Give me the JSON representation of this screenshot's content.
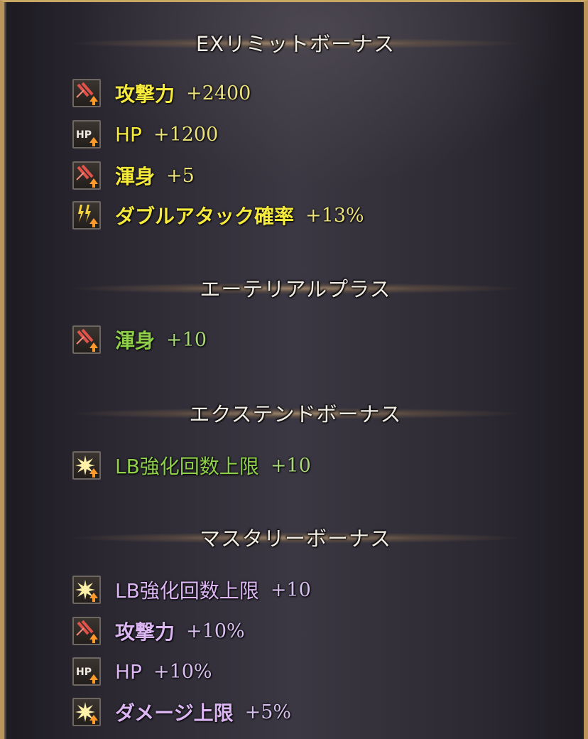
{
  "sections": [
    {
      "title": "EXリミットボーナス",
      "color": "#f6ea3c",
      "items": [
        {
          "icon": "attack-up-icon",
          "label": "攻撃力",
          "value": "+2400"
        },
        {
          "icon": "hp-up-icon",
          "label": "HP",
          "value": "+1200"
        },
        {
          "icon": "attack-up-icon",
          "label": "渾身",
          "value": "+5"
        },
        {
          "icon": "double-attack-up-icon",
          "label": "ダブルアタック確率",
          "value": "+13%"
        }
      ]
    },
    {
      "title": "エーテリアルプラス",
      "color": "#8fcf4a",
      "items": [
        {
          "icon": "attack-up-icon",
          "label": "渾身",
          "value": "+10"
        }
      ]
    },
    {
      "title": "エクステンドボーナス",
      "color": "#8fcf4a",
      "items": [
        {
          "icon": "burst-up-icon",
          "label": "LB強化回数上限",
          "value": "+10"
        }
      ]
    },
    {
      "title": "マスタリーボーナス",
      "color": "#dcb6f3",
      "items": [
        {
          "icon": "burst-up-icon",
          "label": "LB強化回数上限",
          "value": "+10"
        },
        {
          "icon": "attack-up-icon",
          "label": "攻撃力",
          "value": "+10%"
        },
        {
          "icon": "hp-up-icon",
          "label": "HP",
          "value": "+10%"
        },
        {
          "icon": "burst-up-icon",
          "label": "ダメージ上限",
          "value": "+5%"
        }
      ]
    }
  ]
}
